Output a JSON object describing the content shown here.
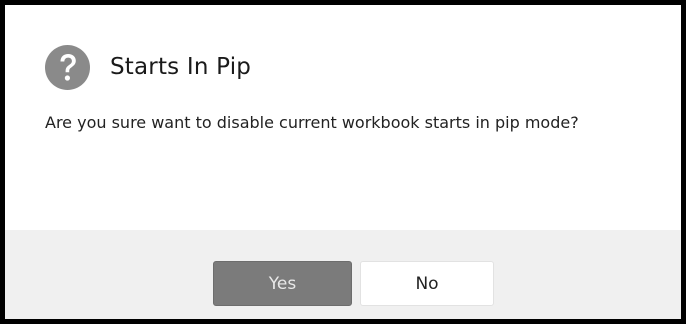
{
  "dialog": {
    "icon": "question-circle-icon",
    "title": "Starts In Pip",
    "message": "Are you sure want to disable current workbook starts in pip mode?",
    "buttons": {
      "yes_label": "Yes",
      "no_label": "No"
    }
  },
  "colors": {
    "icon_bg": "#8a8a8a",
    "primary_button": "#7b7b7b",
    "footer_bg": "#f0f0f0"
  }
}
